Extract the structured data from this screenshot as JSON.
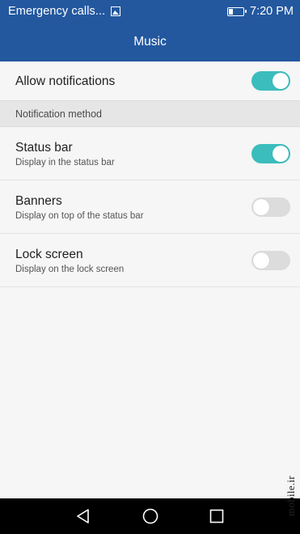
{
  "status_bar": {
    "notification_text": "Emergency calls...",
    "image_icon": "image-icon",
    "battery_icon": "battery-icon",
    "time": "7:20 PM"
  },
  "title_bar": {
    "title": "Music"
  },
  "settings": {
    "allow_notifications": {
      "label": "Allow notifications",
      "enabled": true
    },
    "section_label": "Notification method",
    "items": [
      {
        "title": "Status bar",
        "subtitle": "Display in the status bar",
        "enabled": true
      },
      {
        "title": "Banners",
        "subtitle": "Display on top of the status bar",
        "enabled": false
      },
      {
        "title": "Lock screen",
        "subtitle": "Display on the lock screen",
        "enabled": false
      }
    ]
  },
  "nav_bar": {
    "back_icon": "back-triangle-icon",
    "home_icon": "home-circle-icon",
    "recents_icon": "recents-square-icon"
  },
  "watermark": "mobile.ir",
  "colors": {
    "header": "#23589f",
    "toggle_on": "#3bbdbd",
    "toggle_off": "#dcdcdc",
    "background": "#f6f6f6",
    "section_bg": "#e6e6e6"
  }
}
